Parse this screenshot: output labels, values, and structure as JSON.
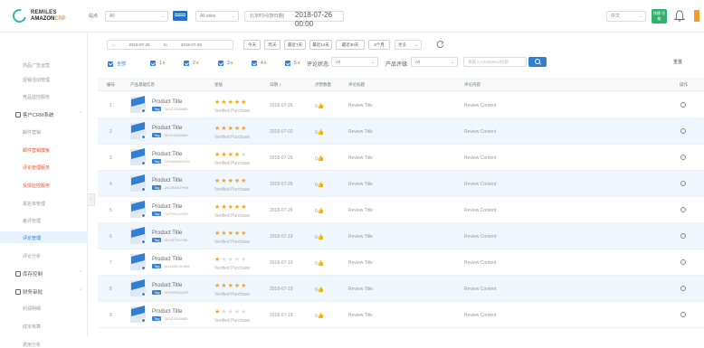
{
  "header": {
    "logo_line1": "REMILES",
    "logo_line2_a": "AMAZON",
    "logo_line2_b": "ERP",
    "site_label": "站点",
    "site_value": "All",
    "region_value": "All sites",
    "date_prefix": "北京时间(按日期)",
    "date_value": "2018-07-26 00:00",
    "lang_value": "中文",
    "green_btn": "快捷\n功能"
  },
  "sidebar": {
    "items": [
      {
        "label": "商品广告运营",
        "type": "item"
      },
      {
        "label": "促销活动管理",
        "type": "item"
      },
      {
        "label": "竞品监控服务",
        "type": "item"
      },
      {
        "label": "客户CRM系统",
        "type": "group"
      },
      {
        "label": "邮件营销",
        "type": "item"
      },
      {
        "label": "邮件营销模板",
        "type": "item",
        "red": true
      },
      {
        "label": "评论管理服务",
        "type": "item",
        "red": true
      },
      {
        "label": "反馈监控服务",
        "type": "item",
        "red": true
      },
      {
        "label": "黑名单管理",
        "type": "item"
      },
      {
        "label": "差评管理",
        "type": "item"
      },
      {
        "label": "评论管理",
        "type": "item",
        "active": true
      },
      {
        "label": "评论分析",
        "type": "item"
      },
      {
        "label": "库存控制",
        "type": "group"
      },
      {
        "label": "财务审批",
        "type": "group"
      },
      {
        "label": "利润明细",
        "type": "item"
      },
      {
        "label": "成本核算",
        "type": "item"
      },
      {
        "label": "费用分析",
        "type": "item"
      }
    ]
  },
  "filters": {
    "date_from": "2018-07-25",
    "date_to": "2018-07-26",
    "date_sep": "to",
    "quick": [
      "今天",
      "昨天",
      "最近7天",
      "最近14天",
      "最近30天",
      "3个月"
    ],
    "more": "更多",
    "checkboxes": [
      {
        "label": "全部",
        "star": ""
      },
      {
        "label": "1",
        "star": "★"
      },
      {
        "label": "2",
        "star": "★"
      },
      {
        "label": "3",
        "star": "★"
      },
      {
        "label": "4",
        "star": "★"
      },
      {
        "label": "5",
        "star": "★"
      }
    ],
    "review_status_label": "评论状态:",
    "review_status_value": "All",
    "product_score_label": "产品评级:",
    "product_score_value": "All",
    "search_placeholder": "请输入ASIN/SKU/标题",
    "reset": "重置"
  },
  "table": {
    "columns": [
      "编号",
      "产品基础信息",
      "星级",
      "日期 ↕",
      "点赞数量",
      "评论标题",
      "评论内容",
      "操作"
    ],
    "rows": [
      {
        "no": "1",
        "title": "Product Title",
        "tag": "Tag",
        "sku": "SKU12345689",
        "stars": 5,
        "verified": "Verified Purchase",
        "date": "2018-07-26",
        "likes": "0",
        "review_title": "Review Title",
        "review_content": "Review Content"
      },
      {
        "no": "2",
        "title": "Product Title",
        "tag": "Tag",
        "sku": "SKU12345689",
        "stars": 5,
        "verified": "Verified Purchase",
        "date": "2018-07-02",
        "likes": "0",
        "review_title": "Review Title",
        "review_content": "Review Content"
      },
      {
        "no": "3",
        "title": "Product Title",
        "tag": "Tag",
        "sku": "2HHAMWOUS1",
        "stars": 4,
        "verified": "Verified Purchase",
        "date": "2018-07-26",
        "likes": "0",
        "review_title": "Review Title",
        "review_content": "Review Content"
      },
      {
        "no": "4",
        "title": "Product Title",
        "tag": "Tag",
        "sku": "2HJ2M0KFHW",
        "stars": 5,
        "verified": "Verified Purchase",
        "date": "2018-07-26",
        "likes": "0",
        "review_title": "Review Title",
        "review_content": "Review Content"
      },
      {
        "no": "5",
        "title": "Product Title",
        "tag": "Tag",
        "sku": "7UTRSLDTBG",
        "stars": 5,
        "verified": "Verified Purchase",
        "date": "2018-07-26",
        "likes": "0",
        "review_title": "Review Title",
        "review_content": "Review Content"
      },
      {
        "no": "6",
        "title": "Product Title",
        "tag": "Tag",
        "sku": "A4OBTVKYB6",
        "stars": 5,
        "verified": "Verified Purchase",
        "date": "2018-07-19",
        "likes": "0",
        "review_title": "Review Title",
        "review_content": "Review Content"
      },
      {
        "no": "7",
        "title": "Product Title",
        "tag": "Tag",
        "sku": "AO1M0LGLMW",
        "stars": 1,
        "verified": "Verified Purchase",
        "date": "2018-07-19",
        "likes": "0",
        "review_title": "Review Title",
        "review_content": "Review Content"
      },
      {
        "no": "8",
        "title": "Product Title",
        "tag": "Tag",
        "sku": "NFH0R02QRR",
        "stars": 5,
        "verified": "Verified Purchase",
        "date": "2018-07-19",
        "likes": "0",
        "review_title": "Review Title",
        "review_content": "Review Content"
      },
      {
        "no": "9",
        "title": "Product Title",
        "tag": "Tag",
        "sku": "SKU12345689",
        "stars": 1,
        "verified": "Verified Purchase",
        "date": "2018-07-19",
        "likes": "0",
        "review_title": "Review Title",
        "review_content": "Review Content"
      }
    ]
  },
  "colors": {
    "accent": "#2f7fd5",
    "star": "#f7a21b",
    "brand": "#2eb5b2",
    "highlight_row": "#f0f6fd"
  }
}
